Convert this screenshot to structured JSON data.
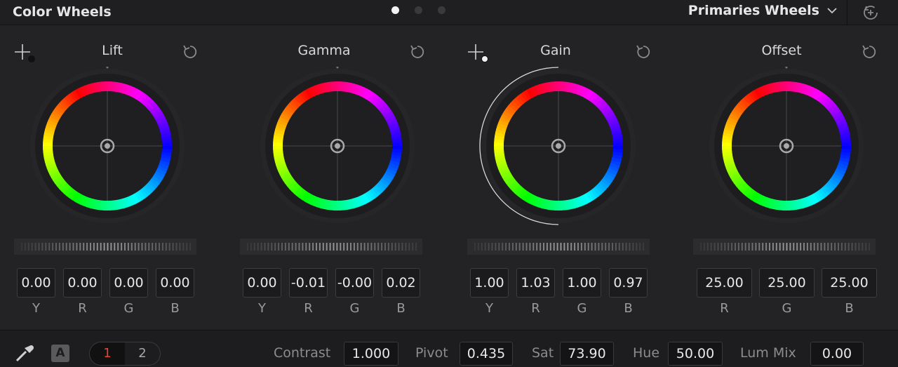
{
  "header": {
    "title": "Color Wheels",
    "mode": "Primaries Wheels",
    "page_dots": [
      true,
      false,
      false
    ]
  },
  "panels": [
    {
      "name": "Lift",
      "values": [
        "0.00",
        "0.00",
        "0.00",
        "0.00"
      ],
      "channels": [
        "Y",
        "R",
        "G",
        "B"
      ]
    },
    {
      "name": "Gamma",
      "values": [
        "0.00",
        "-0.01",
        "-0.00",
        "0.02"
      ],
      "channels": [
        "Y",
        "R",
        "G",
        "B"
      ]
    },
    {
      "name": "Gain",
      "values": [
        "1.00",
        "1.03",
        "1.00",
        "0.97"
      ],
      "channels": [
        "Y",
        "R",
        "G",
        "B"
      ]
    },
    {
      "name": "Offset",
      "values": [
        "25.00",
        "25.00",
        "25.00"
      ],
      "channels": [
        "R",
        "G",
        "B"
      ]
    }
  ],
  "footer": {
    "auto_label": "A",
    "node_tabs": [
      "1",
      "2"
    ],
    "contrast_label": "Contrast",
    "contrast": "1.000",
    "pivot_label": "Pivot",
    "pivot": "0.435",
    "sat_label": "Sat",
    "sat": "73.90",
    "hue_label": "Hue",
    "hue": "50.00",
    "lummix_label": "Lum Mix",
    "lummix": "0.00"
  },
  "icons": {
    "picker": "crosshair-picker-icon",
    "reset": "reset-arrow-icon",
    "eyedropper": "eyedropper-icon",
    "header_reset": "reset-all-icon",
    "dropdown": "chevron-down-icon"
  },
  "colors": {
    "background": "#232325",
    "header": "#1f1f21",
    "toggle_active": "#e0463a"
  }
}
